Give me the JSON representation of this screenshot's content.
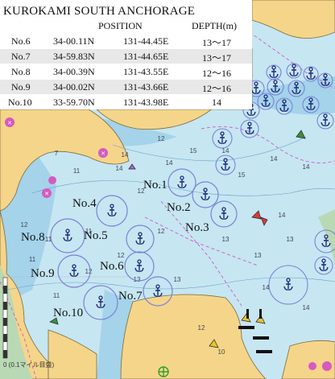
{
  "table": {
    "title": "KUROKAMI SOUTH ANCHORAGE",
    "headers": {
      "position": "POSITION",
      "depth": "DEPTH(m)"
    },
    "rows": [
      {
        "name": "No.6",
        "lat": "34-00.11N",
        "lon": "131-44.45E",
        "depth": "13～17"
      },
      {
        "name": "No.7",
        "lat": "34-59.83N",
        "lon": "131-44.65E",
        "depth": "13～17"
      },
      {
        "name": "No.8",
        "lat": "34-00.39N",
        "lon": "131-43.55E",
        "depth": "12～16"
      },
      {
        "name": "No.9",
        "lat": "34-00.02N",
        "lon": "131-43.66E",
        "depth": "12～16"
      },
      {
        "name": "No.10",
        "lat": "33-59.70N",
        "lon": "131-43.98E",
        "depth": "14"
      }
    ]
  },
  "anchorages": {
    "no1": "No.1",
    "no2": "No.2",
    "no3": "No.3",
    "no4": "No.4",
    "no5": "No.5",
    "no6": "No.6",
    "no7": "No.7",
    "no8": "No.8",
    "no9": "No.9",
    "no10": "No.10"
  },
  "scale_text": "0 (0.1マイル目盛)",
  "colors": {
    "sea": "#c6e6f2",
    "shallow": "#a4d3ea",
    "land": "#f5d58a",
    "intertidal": "#b9d9b4",
    "anchor_ring": "#7b82d6",
    "anchor": "#1f2a7a",
    "restricted": "#d65ac0"
  },
  "icons": [
    "anchor-icon",
    "buoy-icon",
    "lighthouse-icon",
    "restricted-area-icon"
  ]
}
